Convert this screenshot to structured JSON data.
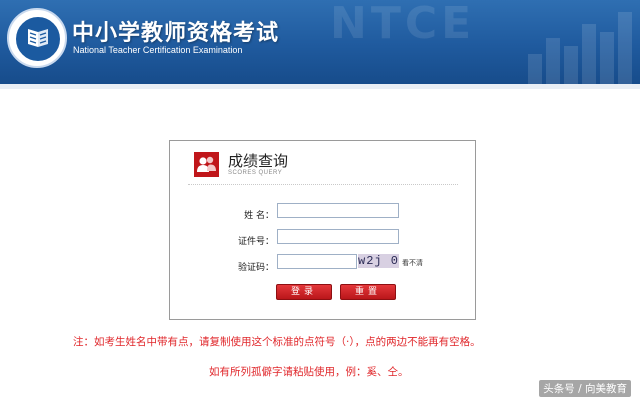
{
  "header": {
    "title_cn": "中小学教师资格考试",
    "title_en": "National Teacher Certification Examination",
    "watermark": "NTCE"
  },
  "panel": {
    "title": "成绩查询",
    "subtitle": "SCORES QUERY",
    "fields": {
      "name_label": "姓  名：",
      "id_label": "证件号：",
      "captcha_label": "验证码：",
      "name_value": "",
      "id_value": "",
      "captcha_value": ""
    },
    "captcha_text": "w2j 0",
    "refresh_text": "看不清",
    "buttons": {
      "submit": "登录",
      "reset": "重置"
    }
  },
  "notes": {
    "line1": "注：如考生姓名中带有点，请复制使用这个标准的点符号（·），点的两边不能再有空格。",
    "line2": "如有所列孤僻字请粘贴使用，例：奚、仝。"
  },
  "source_watermark": "头条号 / 向美教育",
  "colors": {
    "header_blue": "#1f5a9e",
    "accent_red": "#c0161a",
    "note_red": "#e0272b"
  }
}
